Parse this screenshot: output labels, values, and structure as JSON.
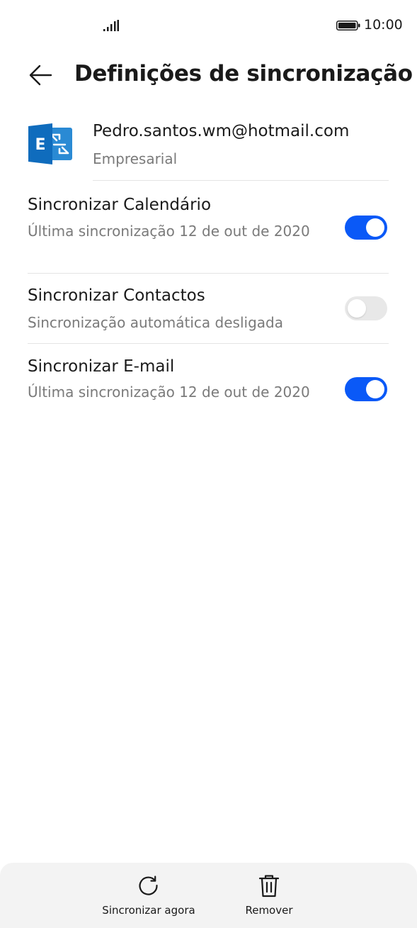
{
  "status_bar": {
    "time": "10:00",
    "icons": [
      "signal-icon",
      "battery-icon"
    ]
  },
  "header": {
    "back_icon": "arrow-left-icon",
    "title": "Definições de sincronização"
  },
  "account": {
    "icon": "microsoft-exchange-icon",
    "email": "Pedro.santos.wm@hotmail.com",
    "type": "Empresarial"
  },
  "sync_items": [
    {
      "title": "Sincronizar Calendário",
      "subtitle": "Última sincronização 12 de out de 2020",
      "enabled": true
    },
    {
      "title": "Sincronizar Contactos",
      "subtitle": "Sincronização automática desligada",
      "enabled": false
    },
    {
      "title": "Sincronizar E-mail",
      "subtitle": "Última sincronização 12 de out de 2020",
      "enabled": true
    }
  ],
  "bottom_actions": {
    "sync_now": {
      "label": "Sincronizar agora",
      "icon": "refresh-icon"
    },
    "remove": {
      "label": "Remover",
      "icon": "trash-icon"
    }
  },
  "colors": {
    "accent": "#0a59f7",
    "toggle_off": "#e8e8e8",
    "exchange_blue": "#0f6cbd",
    "secondary_text": "#7a7a7a"
  }
}
